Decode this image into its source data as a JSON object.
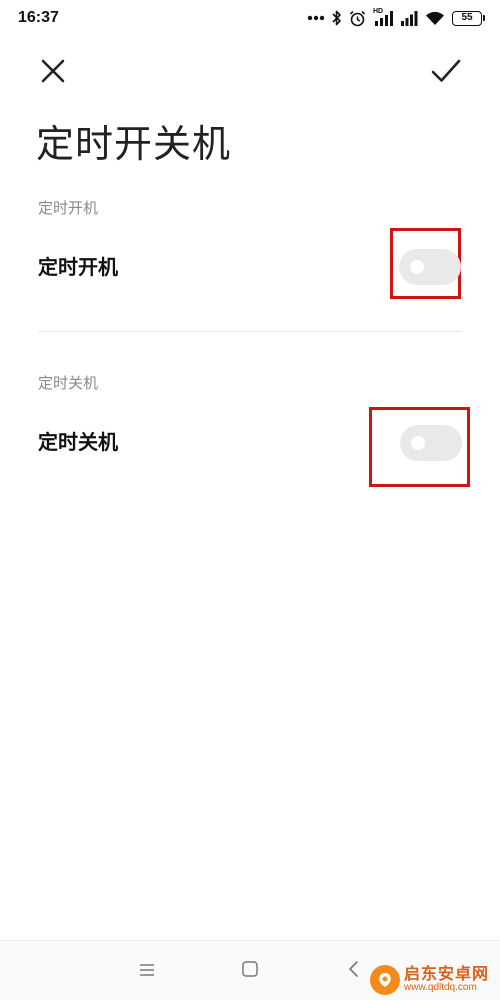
{
  "status_bar": {
    "time": "16:37",
    "battery_level": "55",
    "hd_label": "HD"
  },
  "header": {
    "title": "定时开关机"
  },
  "sections": [
    {
      "header": "定时开机",
      "label": "定时开机",
      "enabled": false
    },
    {
      "header": "定时关机",
      "label": "定时关机",
      "enabled": false
    }
  ],
  "watermark": {
    "title": "启东安卓网",
    "url": "www.qdltdq.com"
  },
  "colors": {
    "highlight": "#d01414",
    "toggle_off": "#e9e9e9",
    "section_header": "#8a8a8a",
    "watermark": "#d9601a"
  },
  "icons": {
    "close": "close-icon",
    "confirm": "checkmark-icon",
    "menu": "menu-icon",
    "home": "home-icon",
    "back": "back-icon"
  }
}
